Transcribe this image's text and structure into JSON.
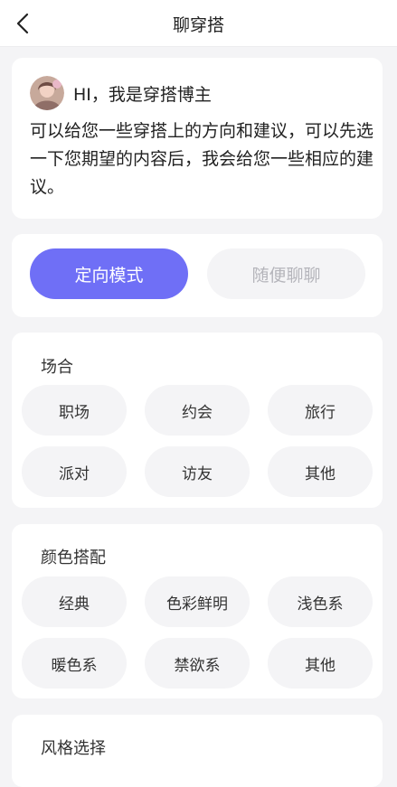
{
  "header": {
    "title": "聊穿搭"
  },
  "intro": {
    "greeting": "HI，我是穿搭博主",
    "text": "可以给您一些穿搭上的方向和建议，可以先选一下您期望的内容后，我会给您一些相应的建议。"
  },
  "modes": [
    {
      "label": "定向模式",
      "active": true
    },
    {
      "label": "随便聊聊",
      "active": false
    }
  ],
  "sections": [
    {
      "title": "场合",
      "options": [
        "职场",
        "约会",
        "旅行",
        "派对",
        "访友",
        "其他"
      ]
    },
    {
      "title": "颜色搭配",
      "options": [
        "经典",
        "色彩鲜明",
        "浅色系",
        "暖色系",
        "禁欲系",
        "其他"
      ]
    },
    {
      "title": "风格选择",
      "options": []
    }
  ],
  "colors": {
    "accent": "#6f6ff6",
    "chip_bg": "#f4f4f6",
    "inactive_text": "#b5b5bb"
  },
  "icons": {
    "back": "chevron-left-icon",
    "avatar": "avatar"
  }
}
